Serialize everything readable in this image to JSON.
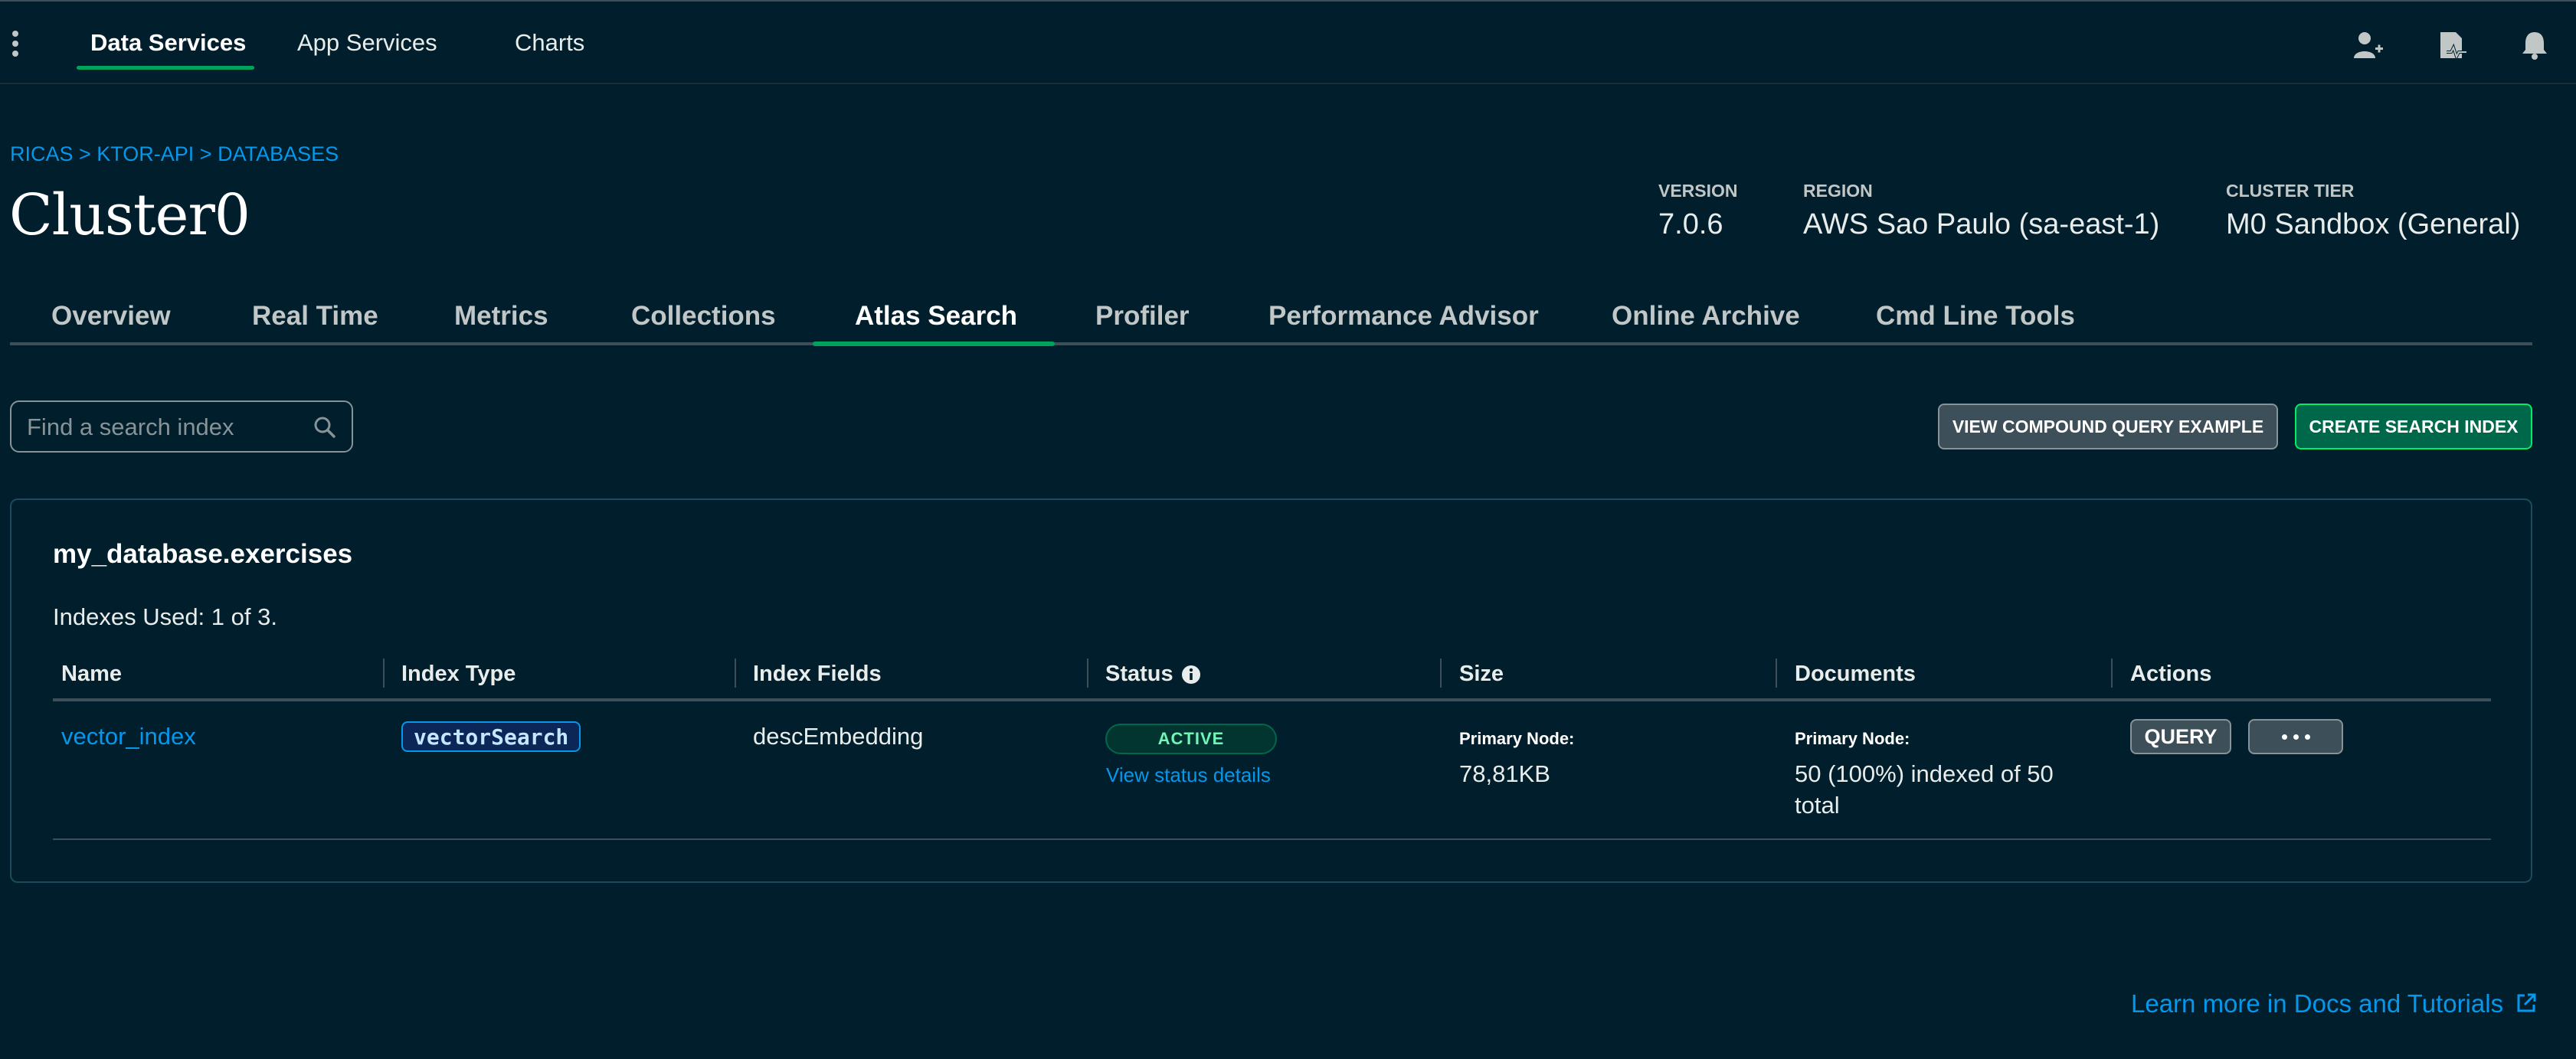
{
  "topnav": {
    "items": [
      {
        "label": "Data Services",
        "active": true
      },
      {
        "label": "App Services",
        "active": false
      },
      {
        "label": "Charts",
        "active": false
      }
    ],
    "icons": [
      "invite-user-icon",
      "activity-feed-icon",
      "notifications-bell-icon"
    ]
  },
  "header": {
    "breadcrumb": "RICAS > KTOR-API > DATABASES",
    "cluster_name": "Cluster0",
    "meta": [
      {
        "label": "VERSION",
        "value": "7.0.6"
      },
      {
        "label": "REGION",
        "value": "AWS Sao Paulo (sa-east-1)"
      },
      {
        "label": "CLUSTER TIER",
        "value": "M0 Sandbox (General)"
      }
    ]
  },
  "tabs": [
    {
      "label": "Overview",
      "active": false
    },
    {
      "label": "Real Time",
      "active": false
    },
    {
      "label": "Metrics",
      "active": false
    },
    {
      "label": "Collections",
      "active": false
    },
    {
      "label": "Atlas Search",
      "active": true
    },
    {
      "label": "Profiler",
      "active": false
    },
    {
      "label": "Performance Advisor",
      "active": false
    },
    {
      "label": "Online Archive",
      "active": false
    },
    {
      "label": "Cmd Line Tools",
      "active": false
    }
  ],
  "search": {
    "placeholder": "Find a search index",
    "value": ""
  },
  "buttons": {
    "compound_query": "VIEW COMPOUND QUERY EXAMPLE",
    "create_index": "CREATE SEARCH INDEX"
  },
  "card": {
    "collection": "my_database.exercises",
    "indexes_used": "Indexes Used: 1 of 3.",
    "columns": [
      "Name",
      "Index Type",
      "Index Fields",
      "Status",
      "Size",
      "Documents",
      "Actions"
    ],
    "rows": [
      {
        "name": "vector_index",
        "index_type": "vectorSearch",
        "index_fields": "descEmbedding",
        "status": "ACTIVE",
        "status_link": "View status details",
        "size_label": "Primary Node:",
        "size_value": "78,81KB",
        "documents_label": "Primary Node:",
        "documents_line1": "50 (100%) indexed of 50",
        "documents_line2": "total",
        "query_label": "QUERY"
      }
    ]
  },
  "footer": {
    "learn_more": "Learn more in Docs and Tutorials"
  },
  "colors": {
    "background": "#001e2b",
    "accent_green": "#00a35c",
    "link_blue": "#0498ec",
    "create_button": "#00684a"
  }
}
